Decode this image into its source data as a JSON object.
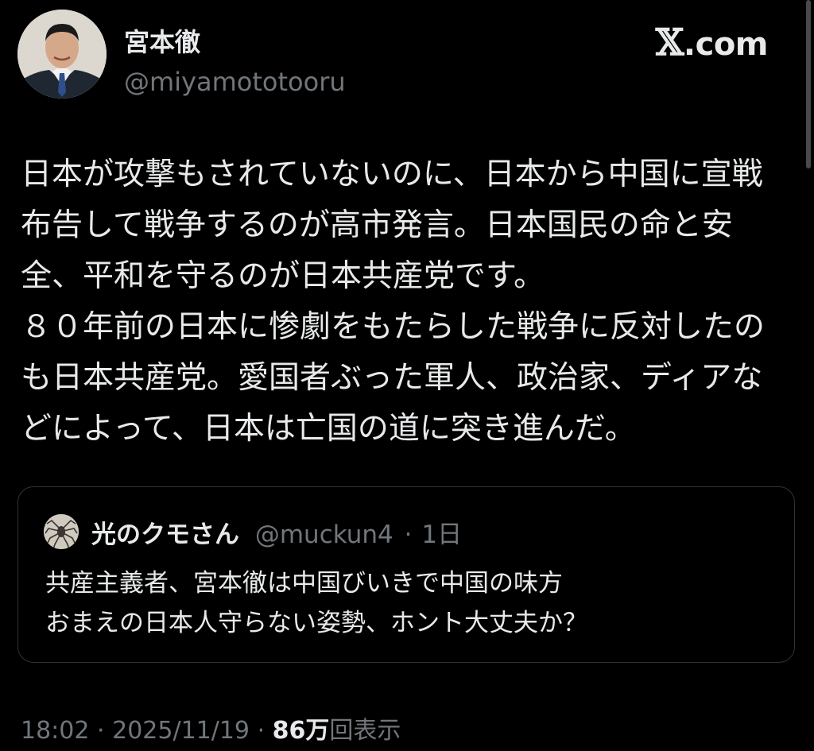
{
  "author": {
    "display_name": "宮本徹",
    "handle": "@miyamototooru"
  },
  "brand": {
    "label_x": "𝕏",
    "label_rest": ".com"
  },
  "tweet": {
    "text": "日本が攻撃もされていないのに、日本から中国に宣戦\n布告して戦争するのが高市発言。日本国民の命と安\n全、平和を守るのが日本共産党です。\n８０年前の日本に惨劇をもたらした戦争に反対したの\nも日本共産党。愛国者ぶった軍人、政治家、ディアな\nどによって、日本は亡国の道に突き進んだ。"
  },
  "quoted_tweet": {
    "display_name": "光のクモさん",
    "handle": "@muckun4",
    "separator": "·",
    "age": "1日",
    "text": "共産主義者、宮本徹は中国びいきで中国の味方\nおまえの日本人守らない姿勢、ホント大丈夫か？"
  },
  "footer": {
    "time": "18:02",
    "sep1": "·",
    "date": "2025/11/19",
    "sep2": "·",
    "views_count": "86万",
    "views_label": "回表示"
  },
  "colors": {
    "background": "#000000",
    "text_primary": "#e7e9ea",
    "text_secondary": "#71767b",
    "border": "#2f3336"
  },
  "icons": {
    "author_avatar": "person-photo-avatar",
    "quoted_avatar": "spider-avatar"
  }
}
